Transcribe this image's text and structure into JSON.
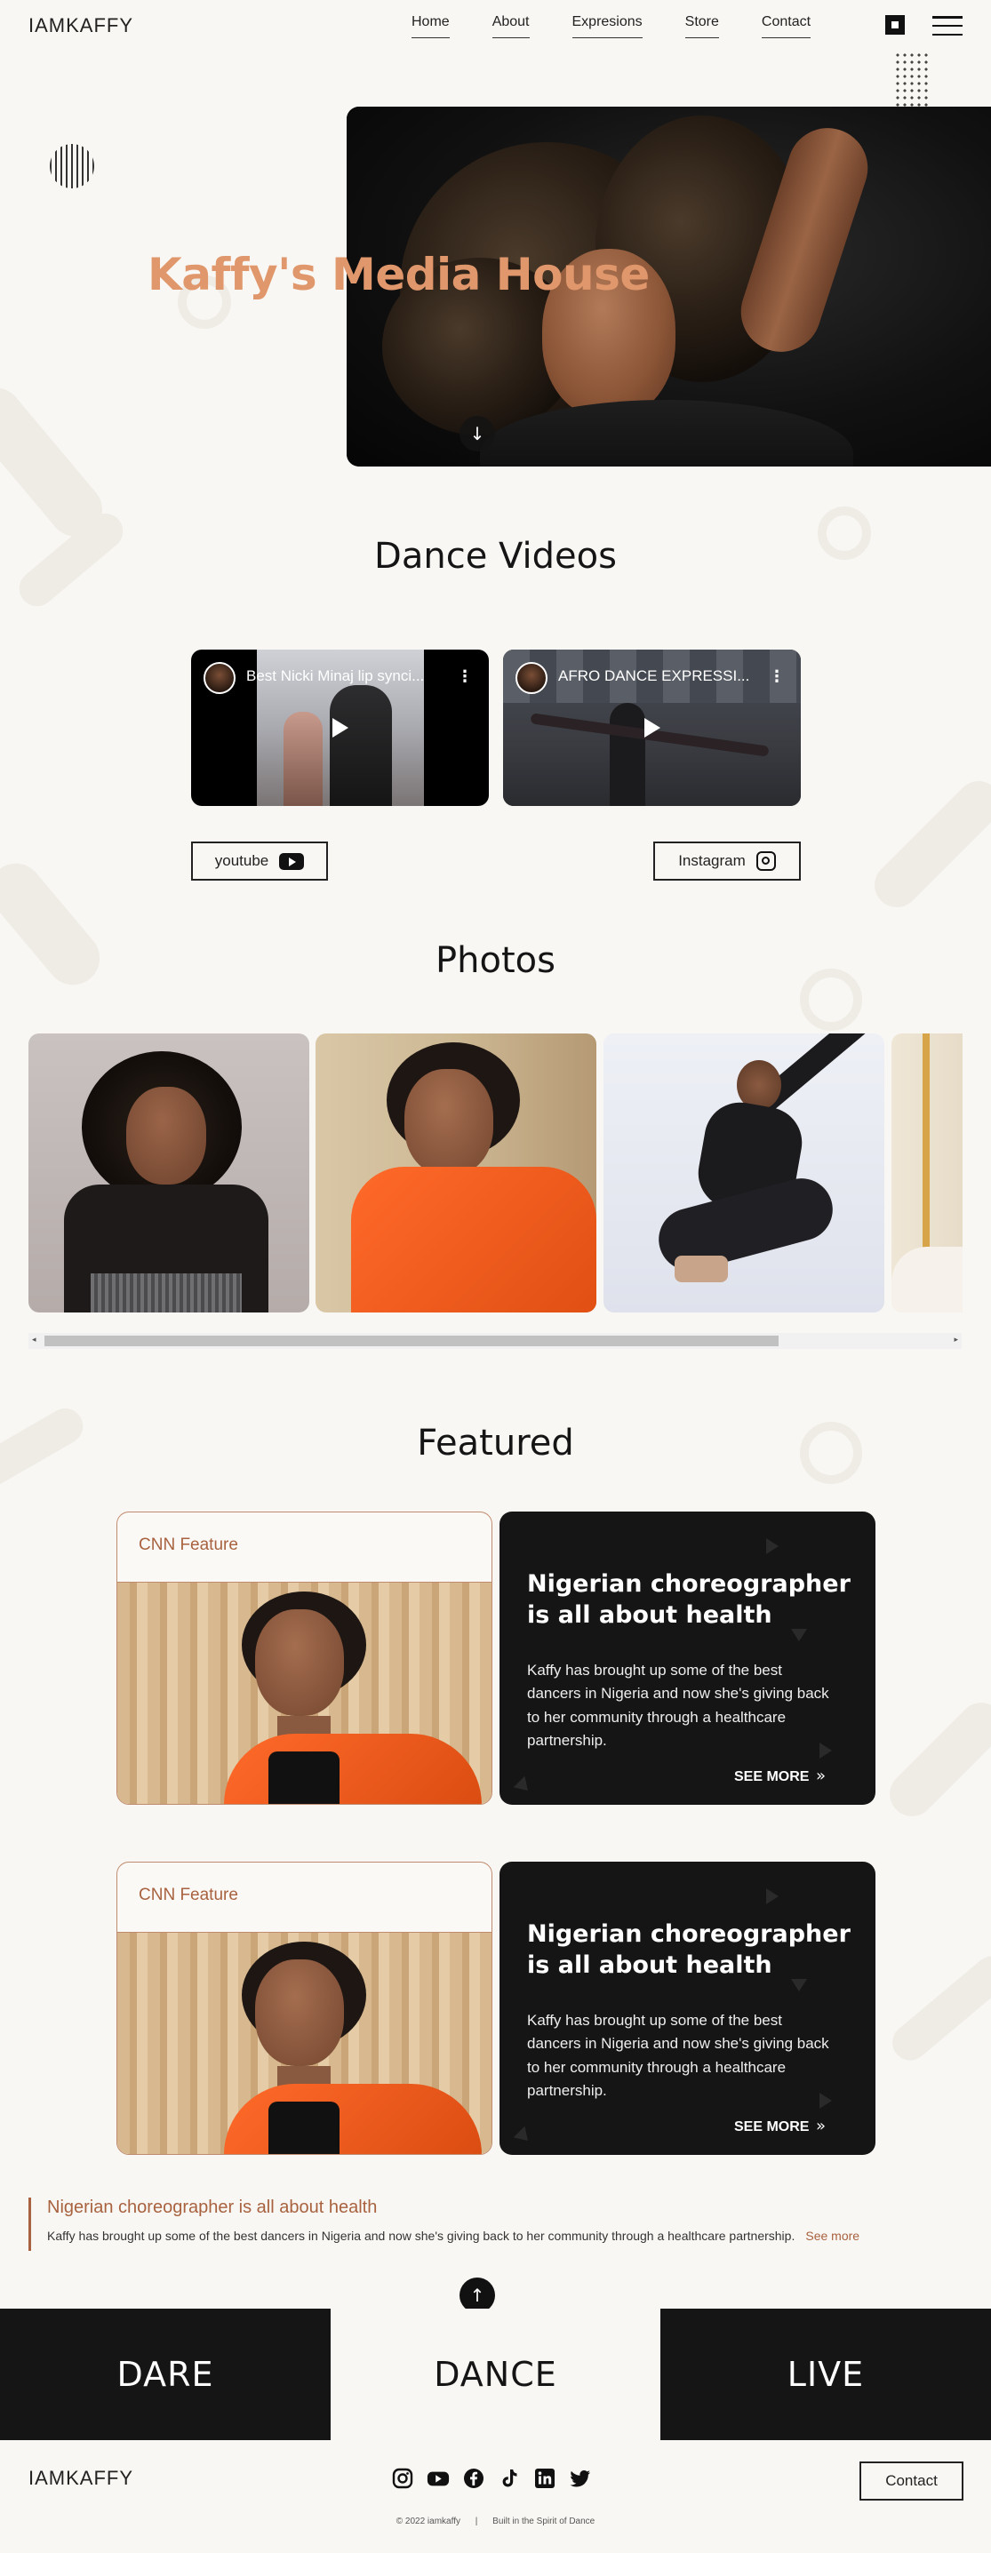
{
  "header": {
    "logo": "IAMKAFFY",
    "nav": [
      "Home",
      "About",
      "Expresions",
      "Store",
      "Contact"
    ]
  },
  "hero": {
    "title": "Kaffy's Media House"
  },
  "videos": {
    "title": "Dance Videos",
    "items": [
      {
        "title": "Best Nicki Minaj lip synci..."
      },
      {
        "title": "AFRO DANCE EXPRESSI..."
      }
    ],
    "youtube_label": "youtube",
    "instagram_label": "Instagram"
  },
  "photos": {
    "title": "Photos"
  },
  "featured": {
    "title": "Featured",
    "cards": [
      {
        "label": "CNN Feature",
        "headline": "Nigerian choreographer is all about health",
        "body": "Kaffy has brought up some of the best dancers in Nigeria and now she's giving back to her community through a healthcare partnership.",
        "more": "SEE MORE"
      },
      {
        "label": "CNN Feature",
        "headline": "Nigerian choreographer is all about health",
        "body": "Kaffy has brought up some of the best dancers in Nigeria and now she's giving back to her community through a healthcare partnership.",
        "more": "SEE MORE"
      }
    ]
  },
  "quote": {
    "title": "Nigerian choreographer is all about health",
    "body": "Kaffy has brought up some of the best dancers in Nigeria and now she's giving back to her community through a healthcare partnership.",
    "more": "See more"
  },
  "band": [
    "DARE",
    "DANCE",
    "LIVE"
  ],
  "footer": {
    "logo": "IAMKAFFY",
    "socials": [
      "instagram-icon",
      "youtube-icon",
      "facebook-icon",
      "tiktok-icon",
      "linkedin-icon",
      "twitter-icon"
    ],
    "contact_label": "Contact",
    "copyright": "© 2022 iamkaffy",
    "separator": "|",
    "tagline": "Built in the Spirit of Dance"
  },
  "colors": {
    "accent": "#e0976c",
    "accent_dark": "#a8623f",
    "dark": "#151515",
    "background": "#f9f7f3"
  }
}
